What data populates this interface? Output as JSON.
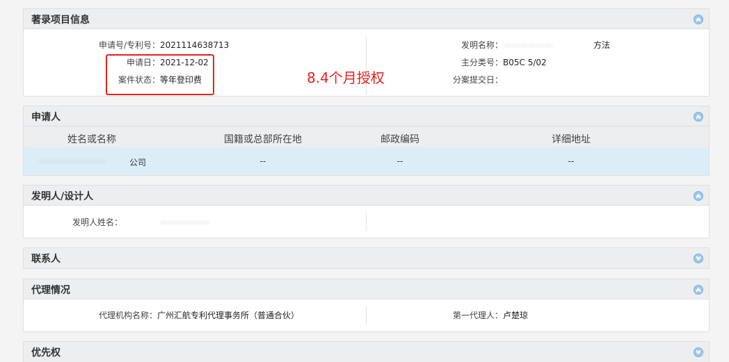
{
  "biblio": {
    "title": "著录项目信息",
    "app_no_label": "申请号/专利号：",
    "app_no_value": "2021114638713",
    "app_date_label": "申请日：",
    "app_date_value": "2021-12-02",
    "status_label": "案件状态：",
    "status_value": "等年登印费",
    "invention_name_label": "发明名称：",
    "invention_name_value_visible": "方法",
    "main_class_label": "主分类号：",
    "main_class_value": "B05C 5/02",
    "division_date_label": "分案提交日：",
    "division_date_value": ""
  },
  "annotation": {
    "text": "8.4个月授权",
    "color": "#e8201a"
  },
  "applicant": {
    "title": "申请人",
    "columns": [
      "姓名或名称",
      "国籍或总部所在地",
      "邮政编码",
      "详细地址"
    ],
    "rows": [
      [
        "公司",
        "--",
        "--",
        "--"
      ]
    ]
  },
  "inventor": {
    "title": "发明人/设计人",
    "name_label": "发明人姓名："
  },
  "contact": {
    "title": "联系人"
  },
  "agency": {
    "title": "代理情况",
    "agency_label": "代理机构名称：",
    "agency_value": "广州汇航专利代理事务所（普通合伙）",
    "agent_label": "第一代理人：",
    "agent_value": "卢楚琼"
  },
  "priority": {
    "title": "优先权"
  },
  "colors": {
    "header_bg": "#eceef0",
    "row_highlight": "#dbeef8",
    "toggle_blue": "#9ec7ea"
  }
}
